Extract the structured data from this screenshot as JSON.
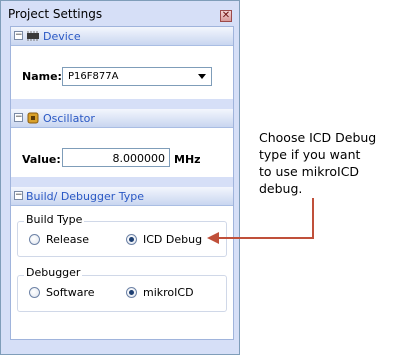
{
  "window": {
    "title": "Project Settings",
    "close_glyph": "✕"
  },
  "device": {
    "header": "Device",
    "icon": "chip-icon",
    "name_label": "Name:",
    "name_value": "P16F877A"
  },
  "oscillator": {
    "header": "Oscillator",
    "icon": "oscillator-icon",
    "value_label": "Value:",
    "value": "8.000000",
    "unit": "MHz"
  },
  "build": {
    "header": "Build/ Debugger Type",
    "build_type": {
      "title": "Build Type",
      "options": [
        "Release",
        "ICD Debug"
      ],
      "selected": "ICD Debug"
    },
    "debugger": {
      "title": "Debugger",
      "options": [
        "Software",
        "mikroICD"
      ],
      "selected": "mikroICD"
    }
  },
  "callout": {
    "lines": [
      "Choose ICD Debug",
      "type if you want",
      "to use mikroICD",
      "debug."
    ],
    "color": "#c0503a"
  },
  "colors": {
    "accent_text": "#2a58c4",
    "panel_bg": "#d6dff7"
  }
}
